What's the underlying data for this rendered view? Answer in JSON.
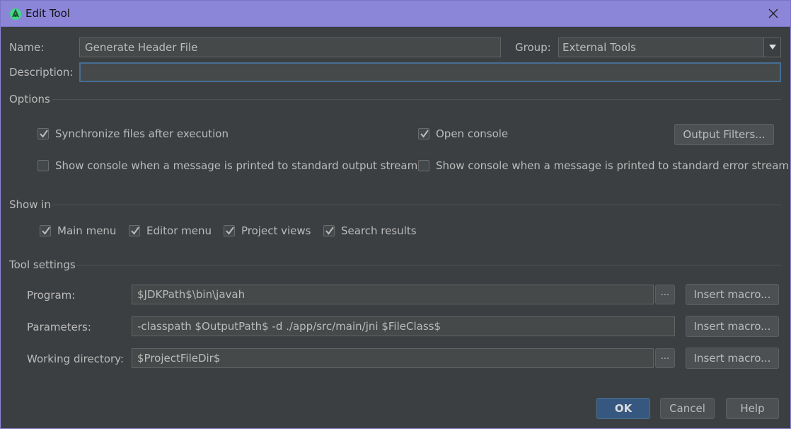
{
  "window": {
    "title": "Edit Tool"
  },
  "form": {
    "name_label": "Name:",
    "name_value": "Generate Header File",
    "group_label": "Group:",
    "group_value": "External Tools",
    "description_label": "Description:",
    "description_value": ""
  },
  "options": {
    "title": "Options",
    "sync_label": "Synchronize files after execution",
    "sync_checked": true,
    "open_console_label": "Open console",
    "open_console_checked": true,
    "output_filters_label": "Output Filters...",
    "show_stdout_label": "Show console when a message is printed to standard output stream",
    "show_stdout_checked": false,
    "show_stderr_label": "Show console when a message is printed to standard error stream",
    "show_stderr_checked": false
  },
  "show_in": {
    "title": "Show in",
    "items": [
      {
        "label": "Main menu",
        "checked": true
      },
      {
        "label": "Editor menu",
        "checked": true
      },
      {
        "label": "Project views",
        "checked": true
      },
      {
        "label": "Search results",
        "checked": true
      }
    ]
  },
  "tool_settings": {
    "title": "Tool settings",
    "program_label": "Program:",
    "program_value": "$JDKPath$\\bin\\javah",
    "parameters_label": "Parameters:",
    "parameters_value": "-classpath $OutputPath$ -d ./app/src/main/jni $FileClass$",
    "workdir_label": "Working directory:",
    "workdir_value": "$ProjectFileDir$",
    "browse_label": "...",
    "insert_macro_label": "Insert macro..."
  },
  "footer": {
    "ok_label": "OK",
    "cancel_label": "Cancel",
    "help_label": "Help"
  },
  "colors": {
    "titlebar": "#8c86d8",
    "background": "#3c3f41",
    "primary_button": "#365880",
    "focus_border": "#466d94"
  },
  "icons": {
    "app": "android-studio-icon",
    "close": "close-icon",
    "dropdown": "triangle-down-icon",
    "check": "checkmark-icon"
  }
}
